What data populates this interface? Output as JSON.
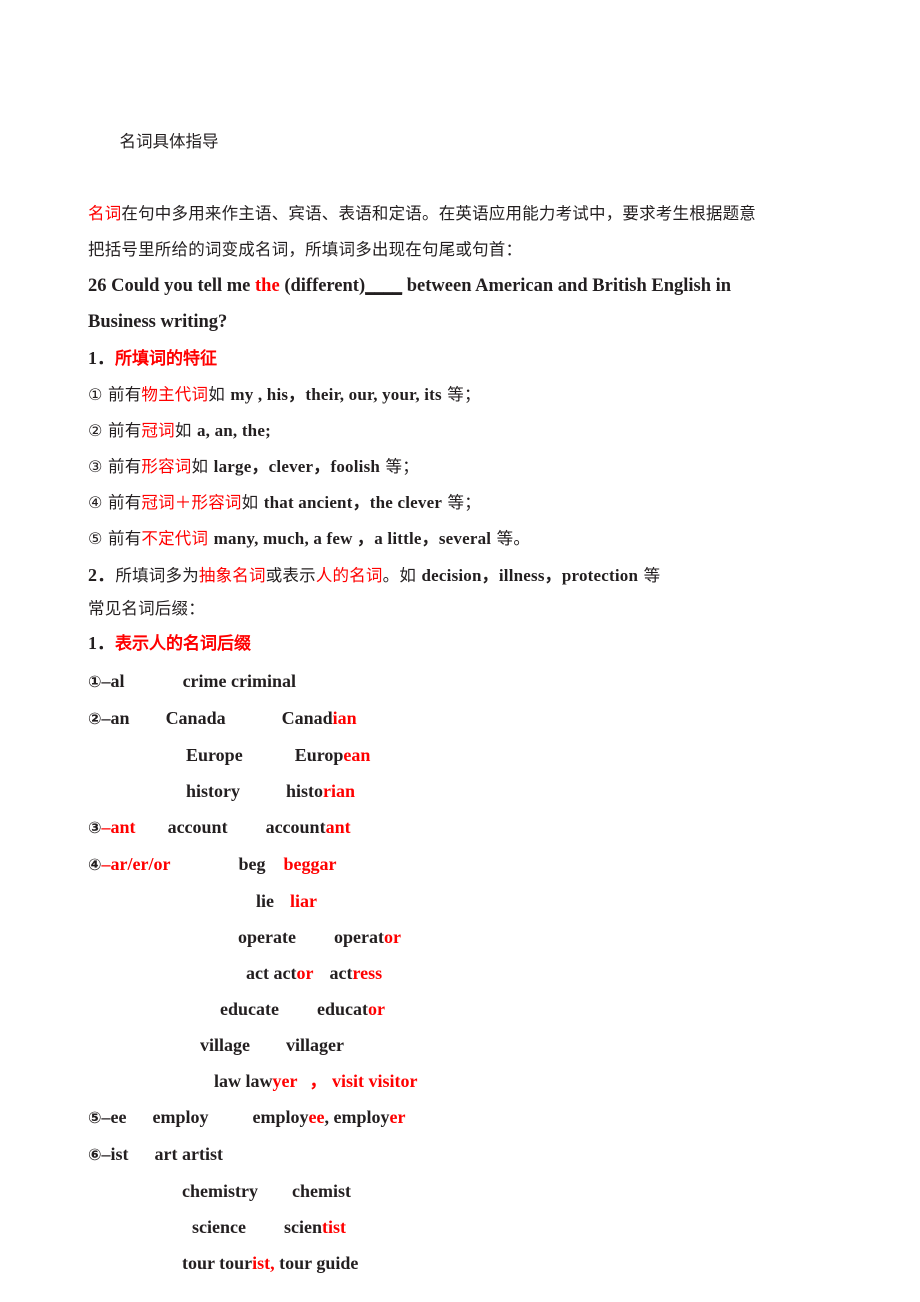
{
  "document": {
    "title": "名词具体指导",
    "intro": {
      "red_lead": "名词",
      "body_1": "在句中多用来作主语、宾语、表语和定语。在英语应用能力考试中，要求考生根据题意",
      "body_2": "把括号里所给的词变成名词，所填词多出现在句尾或句首："
    },
    "example": {
      "prefix": "26 Could you tell me ",
      "red_word": "the",
      "middle": " (different)",
      "blank": "____",
      "suffix": " between American and British English in",
      "line2": "Business writing?"
    },
    "section1": {
      "number": "1．",
      "heading": "所填词的特征",
      "items": [
        {
          "marker": "①",
          "pre": " 前有",
          "red": "物主代词",
          "mid_cn": "如 ",
          "en": "my , his，their, our, your, its",
          "tail": " 等；"
        },
        {
          "marker": "②",
          "pre": " 前有",
          "red": "冠词",
          "mid_cn": "如 ",
          "en": "a, an, the;",
          "tail": ""
        },
        {
          "marker": "③",
          "pre": " 前有",
          "red": "形容词",
          "mid_cn": "如 ",
          "en": "large，clever，foolish",
          "tail": " 等；"
        },
        {
          "marker": "④",
          "pre": " 前有",
          "red": "冠词＋形容词",
          "mid_cn": "如 ",
          "en": "that ancient，the clever",
          "tail": " 等；"
        },
        {
          "marker": "⑤",
          "pre": " 前有",
          "red": "不定代词",
          "mid_cn": " ",
          "en": "many, much, a few ，a little，several",
          "tail": " 等。"
        }
      ]
    },
    "section2": {
      "number": "2．",
      "pre": "所填词多为",
      "red_1": "抽象名词",
      "mid": "或表示",
      "red_2": "人的名词",
      "post": "。如 ",
      "en": "decision，illness，protection",
      "tail": " 等",
      "line2": "常见名词后缀："
    },
    "section3": {
      "number": "1．",
      "heading": "表示人的名词后缀"
    },
    "suffix_list": [
      {
        "marker": "①",
        "suffix": "–al",
        "suffix_red": false,
        "rows": [
          {
            "indent": 100,
            "base": "crime criminal",
            "base_red": "",
            "deriv": "",
            "deriv_red": "",
            "tail": ""
          }
        ]
      },
      {
        "marker": "②",
        "suffix": "–an",
        "suffix_red": false,
        "rows": [
          {
            "indent": 100,
            "base": "Canada",
            "gap": 62,
            "deriv": "Canad",
            "deriv_red": "ian"
          },
          {
            "indent": 100,
            "base": "Europe",
            "gap": 56,
            "deriv": "Europ",
            "deriv_red": "ean"
          },
          {
            "indent": 100,
            "base": "history",
            "gap": 48,
            "deriv": "histo",
            "deriv_red": "rian"
          }
        ]
      },
      {
        "marker": "③",
        "suffix": "–ant",
        "suffix_red": true,
        "rows": [
          {
            "indent": 100,
            "base": "account",
            "gap": 52,
            "deriv": "account",
            "deriv_red": "ant"
          }
        ]
      },
      {
        "marker": "④",
        "suffix": "–ar/er/or",
        "suffix_red": true,
        "rows": [
          {
            "indent": 188,
            "base": "beg",
            "gap": 22,
            "deriv": "",
            "deriv_red": "beggar"
          },
          {
            "indent": 172,
            "base": "lie",
            "gap": 16,
            "deriv": "",
            "deriv_red": "liar"
          },
          {
            "indent": 155,
            "base": "operate",
            "gap": 44,
            "deriv": "operat",
            "deriv_red": "or"
          },
          {
            "indent": 140,
            "base": "act act",
            "gap": 0,
            "deriv": "",
            "deriv_red": "or",
            "extra": "  act",
            "extra_red": "ress"
          },
          {
            "indent": 120,
            "base": "educate",
            "gap": 44,
            "deriv": "educat",
            "deriv_red": "or"
          },
          {
            "indent": 100,
            "base": "village",
            "gap": 44,
            "deriv": "villager",
            "deriv_red": ""
          },
          {
            "indent": 118,
            "base": "law law",
            "gap": 0,
            "deriv": "",
            "deriv_red": "yer",
            "extra2_red": "， visit visit",
            "extra2_tail_red": "or"
          }
        ]
      },
      {
        "marker": "⑤",
        "suffix": "–ee",
        "suffix_red": false,
        "rows": [
          {
            "indent": 100,
            "base": "employ",
            "gap": 48,
            "deriv": "employ",
            "deriv_red": "ee"
          }
        ]
      },
      {
        "marker": "⑥",
        "suffix": "–ist",
        "suffix_red": false,
        "rows": [
          {
            "indent": 100,
            "base": "art artist",
            "gap": 0,
            "deriv": "",
            "deriv_red": ""
          },
          {
            "indent": 100,
            "base": "chemistry",
            "gap": 42,
            "deriv": "chemist",
            "deriv_red": ""
          },
          {
            "indent": 106,
            "base": "science",
            "gap": 46,
            "deriv": "scien",
            "deriv_red": "tist"
          },
          {
            "indent": 100,
            "base": "tour tour",
            "gap": 0,
            "deriv": "",
            "deriv_red": "ist,"
          }
        ]
      }
    ],
    "word_lines": {
      "l_al": {
        "marker": "①",
        "suffix": "–al",
        "word": "crime criminal"
      },
      "l_an": {
        "marker": "②",
        "suffix": "–an",
        "base": "Canada",
        "stem": "Canad",
        "red": "ian"
      },
      "l_an2": {
        "base": "Europe",
        "stem": "Europ",
        "red": "ean"
      },
      "l_an3": {
        "base": "history",
        "stem": "histo",
        "red": "rian"
      },
      "l_ant": {
        "marker": "③",
        "suffix": "–ant",
        "base": "account",
        "stem": "account",
        "red": "ant"
      },
      "l_ar": {
        "marker": "④",
        "suffix": "–ar/er/or",
        "base": "beg",
        "red": "beggar"
      },
      "l_lie": {
        "base": "lie",
        "red": "liar"
      },
      "l_operate": {
        "base": "operate",
        "stem": "operat",
        "red": "or"
      },
      "l_act": {
        "base": "act act",
        "red": "or",
        "base2": "act",
        "red2": "ress"
      },
      "l_educate": {
        "base": "educate",
        "stem": "educat",
        "red": "or"
      },
      "l_village": {
        "base": "village",
        "stem": "villager"
      },
      "l_law": {
        "base": "law law",
        "red": "yer",
        "red_comma": "， visit visit",
        "red2": "or"
      },
      "l_ee": {
        "marker": "⑤",
        "suffix": "–ee",
        "base": "employ",
        "stem": "employ",
        "red": "ee",
        "stem2": ", employ",
        "red2": "er"
      },
      "l_ist": {
        "marker": "⑥",
        "suffix": "–ist",
        "base": "art artist"
      },
      "l_chem": {
        "base": "chemistry",
        "stem": "chemist"
      },
      "l_sci": {
        "base": "science",
        "stem": "scien",
        "red": "tist"
      },
      "l_tour": {
        "base": "tour tour",
        "red": "ist,",
        "tail": " tour guide"
      }
    }
  }
}
